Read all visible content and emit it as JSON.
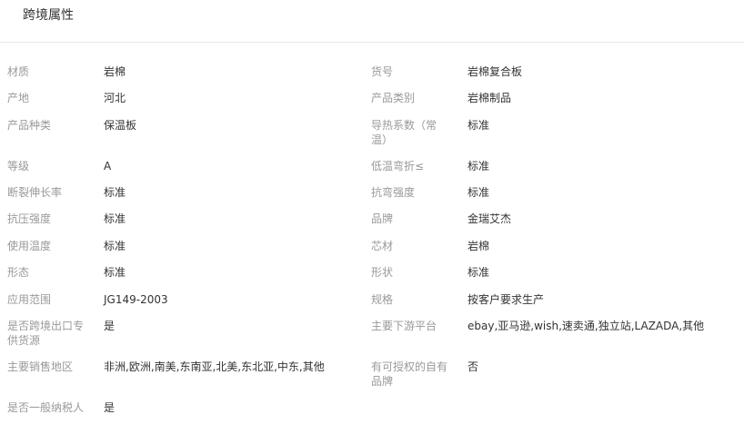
{
  "header": {
    "title": "跨境属性"
  },
  "left": [
    {
      "label": "材质",
      "value": "岩棉"
    },
    {
      "label": "产地",
      "value": "河北"
    },
    {
      "label": "产品种类",
      "value": "保温板"
    },
    {
      "label": "等级",
      "value": "A"
    },
    {
      "label": "断裂伸长率",
      "value": "标准"
    },
    {
      "label": "抗压强度",
      "value": "标准"
    },
    {
      "label": "使用温度",
      "value": "标准"
    },
    {
      "label": "形态",
      "value": "标准"
    },
    {
      "label": "应用范围",
      "value": "JG149-2003"
    },
    {
      "label": "是否跨境出口专供货源",
      "value": "是"
    },
    {
      "label": "主要销售地区",
      "value": "非洲,欧洲,南美,东南亚,北美,东北亚,中东,其他"
    },
    {
      "label": "是否一般纳税人",
      "value": "是"
    }
  ],
  "right": [
    {
      "label": "货号",
      "value": "岩棉复合板"
    },
    {
      "label": "产品类别",
      "value": "岩棉制品"
    },
    {
      "label": "导热系数（常温）",
      "value": "标准"
    },
    {
      "label": "低温弯折≤",
      "value": "标准"
    },
    {
      "label": "抗弯强度",
      "value": "标准"
    },
    {
      "label": "品牌",
      "value": "金瑞艾杰"
    },
    {
      "label": "芯材",
      "value": "岩棉"
    },
    {
      "label": "形状",
      "value": "标准"
    },
    {
      "label": "规格",
      "value": "按客户要求生产"
    },
    {
      "label": "主要下游平台",
      "value": "ebay,亚马逊,wish,速卖通,独立站,LAZADA,其他"
    },
    {
      "label": "有可授权的自有品牌",
      "value": "否"
    }
  ]
}
